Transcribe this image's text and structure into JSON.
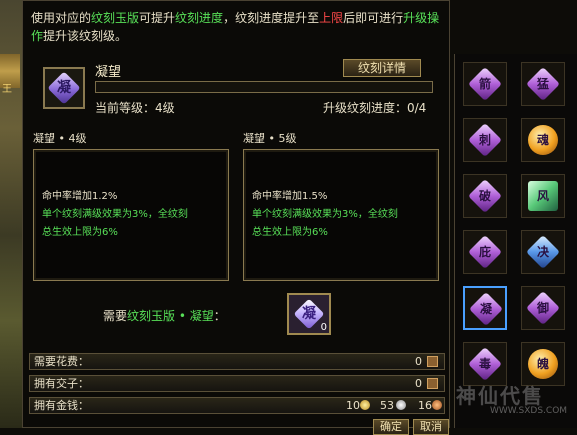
{
  "notice": {
    "p1": "使用对应的",
    "g1": "纹刻玉版",
    "p2": "可提升",
    "g2": "纹刻进度",
    "p3": "，纹刻进度提升至",
    "r1": "上限",
    "p4": "后即可进行",
    "g3": "升级操作",
    "p5": "提升该纹刻级。"
  },
  "header": {
    "icon_char": "凝",
    "name": "凝望",
    "detail_button": "纹刻详情",
    "current_level": "当前等级：4级",
    "progress_label": "升级纹刻进度：0/4"
  },
  "current": {
    "title": "凝望 • 4级",
    "line1": "命中率增加1.2%",
    "line2": "单个纹刻满级效果为3%，全纹刻",
    "line3": "总生效上限为6%"
  },
  "next": {
    "title": "凝望 • 5级",
    "line1": "命中率增加1.5%",
    "line2": "单个纹刻满级效果为3%，全纹刻",
    "line3": "总生效上限为6%"
  },
  "need": {
    "prefix": "需要",
    "item": "纹刻玉版 • 凝望",
    "suffix": "：",
    "slot_char": "凝",
    "count": "0"
  },
  "rows": {
    "cost_label": "需要花费：",
    "cost_value": "0",
    "jiaozi_label": "拥有交子：",
    "jiaozi_value": "0",
    "money_label": "拥有金钱：",
    "gold": "10",
    "silver": "53",
    "copper": "16"
  },
  "buttons": {
    "confirm": "确定",
    "cancel": "取消"
  },
  "side_gems": [
    {
      "char": "箭",
      "color": "purple"
    },
    {
      "char": "猛",
      "color": "purple"
    },
    {
      "char": "刺",
      "color": "purple"
    },
    {
      "char": "魂",
      "color": "orange"
    },
    {
      "char": "破",
      "color": "purple"
    },
    {
      "char": "风",
      "color": "green"
    },
    {
      "char": "庇",
      "color": "purple"
    },
    {
      "char": "决",
      "color": "blue"
    },
    {
      "char": "凝",
      "color": "purple",
      "selected": true
    },
    {
      "char": "御",
      "color": "purple"
    },
    {
      "char": "毒",
      "color": "purple"
    },
    {
      "char": "魄",
      "color": "orange"
    }
  ],
  "watermark": {
    "text": "神仙代售",
    "url": "WWW.SXDS.COM"
  },
  "side_left": {
    "label": "王"
  }
}
